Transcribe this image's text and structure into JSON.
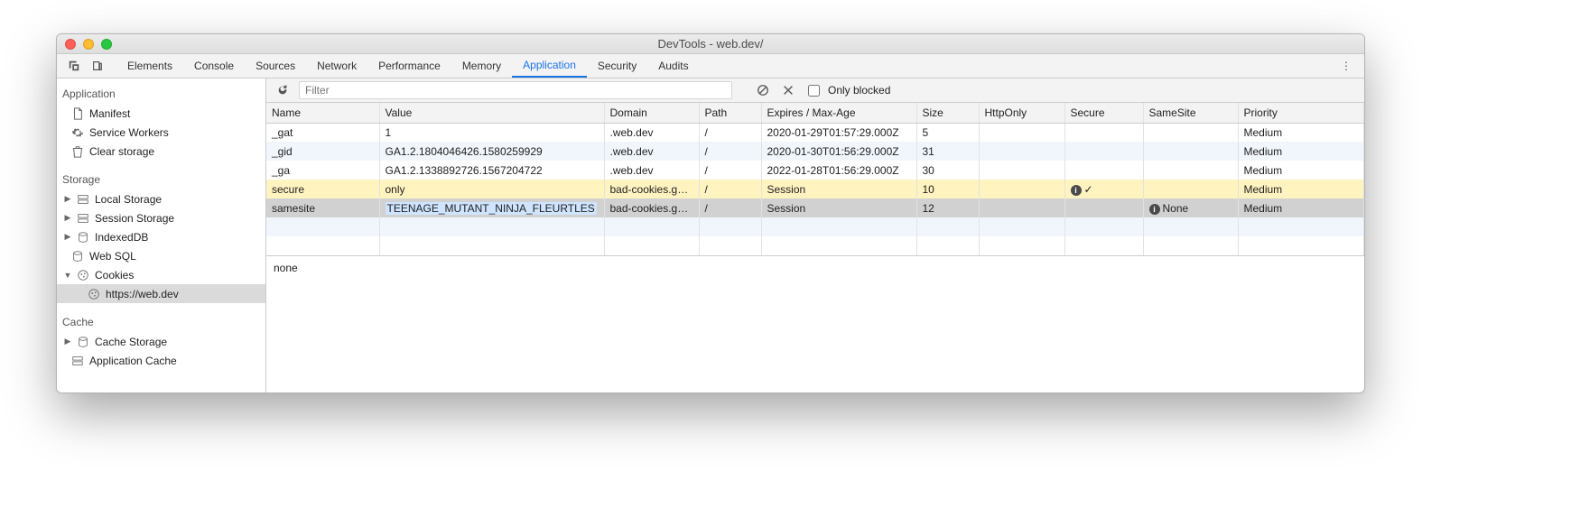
{
  "window_title": "DevTools - web.dev/",
  "tabs": [
    "Elements",
    "Console",
    "Sources",
    "Network",
    "Performance",
    "Memory",
    "Application",
    "Security",
    "Audits"
  ],
  "active_tab": "Application",
  "sidebar": {
    "sections": {
      "application": {
        "title": "Application",
        "items": [
          {
            "label": "Manifest"
          },
          {
            "label": "Service Workers"
          },
          {
            "label": "Clear storage"
          }
        ]
      },
      "storage": {
        "title": "Storage",
        "items": [
          {
            "label": "Local Storage",
            "expandable": true,
            "expanded": false
          },
          {
            "label": "Session Storage",
            "expandable": true,
            "expanded": false
          },
          {
            "label": "IndexedDB",
            "expandable": true,
            "expanded": false
          },
          {
            "label": "Web SQL"
          },
          {
            "label": "Cookies",
            "expandable": true,
            "expanded": true,
            "children": [
              {
                "label": "https://web.dev",
                "selected": true
              }
            ]
          }
        ]
      },
      "cache": {
        "title": "Cache",
        "items": [
          {
            "label": "Cache Storage",
            "expandable": true,
            "expanded": false
          },
          {
            "label": "Application Cache"
          }
        ]
      }
    }
  },
  "toolbar": {
    "filter_placeholder": "Filter",
    "filter_value": "",
    "only_blocked_label": "Only blocked",
    "only_blocked_checked": false
  },
  "table": {
    "headers": [
      "Name",
      "Value",
      "Domain",
      "Path",
      "Expires / Max-Age",
      "Size",
      "HttpOnly",
      "Secure",
      "SameSite",
      "Priority"
    ],
    "rows": [
      {
        "name": "_gat",
        "value": "1",
        "domain": ".web.dev",
        "path": "/",
        "expires": "2020-01-29T01:57:29.000Z",
        "size": "5",
        "httponly": "",
        "secure": "",
        "samesite": "",
        "priority": "Medium"
      },
      {
        "name": "_gid",
        "value": "GA1.2.1804046426.1580259929",
        "domain": ".web.dev",
        "path": "/",
        "expires": "2020-01-30T01:56:29.000Z",
        "size": "31",
        "httponly": "",
        "secure": "",
        "samesite": "",
        "priority": "Medium"
      },
      {
        "name": "_ga",
        "value": "GA1.2.1338892726.1567204722",
        "domain": ".web.dev",
        "path": "/",
        "expires": "2022-01-28T01:56:29.000Z",
        "size": "30",
        "httponly": "",
        "secure": "",
        "samesite": "",
        "priority": "Medium"
      },
      {
        "name": "secure",
        "value": "only",
        "domain": "bad-cookies.g…",
        "path": "/",
        "expires": "Session",
        "size": "10",
        "httponly": "",
        "secure_icon": true,
        "secure": "✓",
        "samesite": "",
        "priority": "Medium",
        "warn": true
      },
      {
        "name": "samesite",
        "value": "TEENAGE_MUTANT_NINJA_FLEURTLES",
        "domain": "bad-cookies.g…",
        "path": "/",
        "expires": "Session",
        "size": "12",
        "httponly": "",
        "secure": "",
        "samesite_icon": true,
        "samesite": "None",
        "priority": "Medium",
        "selected": true,
        "editing": true
      }
    ],
    "empty_rows": 2
  },
  "detail": "none"
}
